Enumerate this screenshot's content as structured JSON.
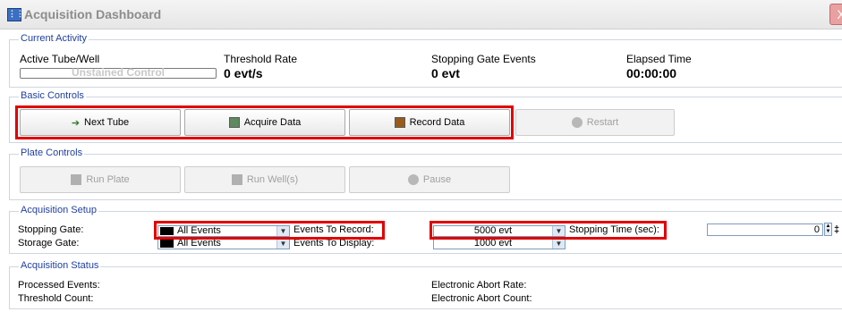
{
  "window": {
    "title": "Acquisition Dashboard",
    "icon": "app-grid-icon",
    "close_glyph": "X"
  },
  "current_activity": {
    "legend": "Current Activity",
    "active_label": "Active Tube/Well",
    "active_value": "Unstained Control",
    "threshold_label": "Threshold Rate",
    "threshold_value": "0 evt/s",
    "stopping_label": "Stopping Gate Events",
    "stopping_value": "0 evt",
    "elapsed_label": "Elapsed Time",
    "elapsed_value": "00:00:00"
  },
  "basic_controls": {
    "legend": "Basic Controls",
    "next_tube": "Next Tube",
    "acquire": "Acquire Data",
    "record": "Record Data",
    "restart": "Restart"
  },
  "plate_controls": {
    "legend": "Plate Controls",
    "run_plate": "Run Plate",
    "run_wells": "Run Well(s)",
    "pause": "Pause"
  },
  "acquisition_setup": {
    "legend": "Acquisition Setup",
    "stopping_gate_label": "Stopping Gate:",
    "stopping_gate_value": "All Events",
    "storage_gate_label": "Storage Gate:",
    "storage_gate_value": "All Events",
    "events_to_record_label": "Events To Record:",
    "events_to_record_value": "5000 evt",
    "events_to_display_label": "Events To Display:",
    "events_to_display_value": "1000 evt",
    "stopping_time_label": "Stopping Time (sec):",
    "stopping_time_value": "0"
  },
  "acquisition_status": {
    "legend": "Acquisition Status",
    "processed_label": "Processed Events:",
    "threshold_count_label": "Threshold Count:",
    "abort_rate_label": "Electronic Abort Rate:",
    "abort_count_label": "Electronic Abort Count:"
  },
  "colors": {
    "legend": "#1f3f9e",
    "highlight": "#e00000",
    "acquire_swatch": "#5f8a5f",
    "record_swatch": "#9a5a1a"
  }
}
